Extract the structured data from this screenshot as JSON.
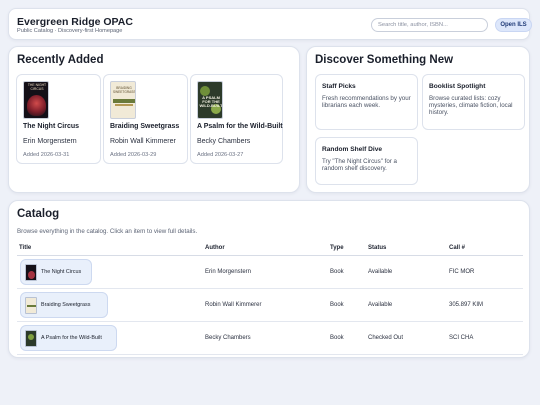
{
  "header": {
    "title": "Evergreen Ridge OPAC",
    "subtitle": "Public Catalog · Discovery-first Homepage",
    "search_placeholder": "Search title, author, ISBN...",
    "open_ils_label": "Open ILS"
  },
  "recent": {
    "heading": "Recently Added",
    "books": [
      {
        "title": "The Night Circus",
        "author": "Erin Morgenstern",
        "added": "Added 2026-03-31",
        "cover_text": "THE NIGHT CIRCUS"
      },
      {
        "title": "Braiding Sweetgrass",
        "author": "Robin Wall Kimmerer",
        "added": "Added 2026-03-29",
        "cover_text": "BRAIDING SWEETGRASS"
      },
      {
        "title": "A Psalm for the Wild-Built",
        "author": "Becky Chambers",
        "added": "Added 2026-03-27",
        "cover_text": "A PSALM FOR THE WILD-BUILT"
      }
    ]
  },
  "discover": {
    "heading": "Discover Something New",
    "tiles": [
      {
        "title": "Staff Picks",
        "desc": "Fresh recommendations by your librarians each week."
      },
      {
        "title": "Booklist Spotlight",
        "desc": "Browse curated lists: cozy mysteries, climate fiction, local history."
      },
      {
        "title": "Random Shelf Dive",
        "desc": "Try \"The Night Circus\" for a random shelf discovery."
      }
    ]
  },
  "catalog": {
    "heading": "Catalog",
    "description": "Browse everything in the catalog. Click an item to view full details.",
    "columns": [
      "Title",
      "Author",
      "Type",
      "Status",
      "Call #"
    ],
    "rows": [
      {
        "title": "The Night Circus",
        "author": "Erin Morgenstern",
        "type": "Book",
        "status": "Available",
        "call": "FIC MOR"
      },
      {
        "title": "Braiding Sweetgrass",
        "author": "Robin Wall Kimmerer",
        "type": "Book",
        "status": "Available",
        "call": "305.897 KIM"
      },
      {
        "title": "A Psalm for the Wild-Built",
        "author": "Becky Chambers",
        "type": "Book",
        "status": "Checked Out",
        "call": "SCI CHA"
      }
    ]
  },
  "colors": {
    "page_bg": "#eef1f8",
    "accent": "#dde7fb",
    "accent_text": "#1f3a77",
    "chip_bg": "#e9f0fb"
  }
}
